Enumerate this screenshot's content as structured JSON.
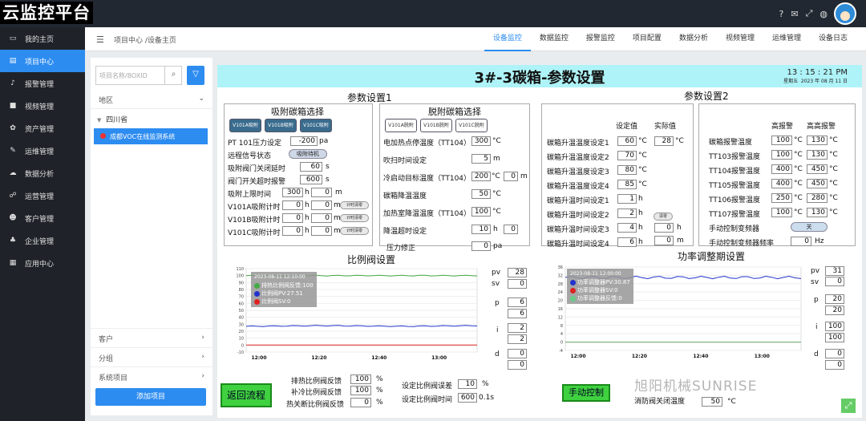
{
  "app": {
    "logo": "云监控平台"
  },
  "topbar_icons": [
    "?",
    "✉",
    "⤢",
    "◍"
  ],
  "sidebar": [
    {
      "label": "我的主页",
      "icon": "▭"
    },
    {
      "label": "项目中心",
      "icon": "▤",
      "active": true
    },
    {
      "label": "报警管理",
      "icon": "♪"
    },
    {
      "label": "视频管理",
      "icon": "■"
    },
    {
      "label": "资产管理",
      "icon": "✿"
    },
    {
      "label": "运维管理",
      "icon": "✎"
    },
    {
      "label": "数据分析",
      "icon": "☁"
    },
    {
      "label": "运营管理",
      "icon": "☍"
    },
    {
      "label": "客户管理",
      "icon": "☻"
    },
    {
      "label": "企业管理",
      "icon": "♣"
    },
    {
      "label": "应用中心",
      "icon": "▦"
    }
  ],
  "header": {
    "breadcrumb": "项目中心 /设备主页",
    "tabs": [
      "设备监控",
      "数据监控",
      "报警监控",
      "项目配置",
      "数据分析",
      "视频管理",
      "运维管理",
      "设备日志"
    ]
  },
  "left": {
    "search_placeholder": "项目名称/BOXID",
    "region": "地区",
    "province": "四川省",
    "project": "成都VOC在线监测系统",
    "bottom": [
      "客户",
      "分组",
      "系统项目"
    ],
    "add_button": "添加项目"
  },
  "main": {
    "title": "3#-3碳箱-参数设置",
    "time": "13 : 15 : 21  PM",
    "date_label": "星期五",
    "date": "2023 年 08 月 11 日",
    "params1": {
      "title": "参数设置1",
      "adsorb": {
        "title": "吸附碳箱选择",
        "buttons": [
          "V101A吸附",
          "V101B吸附",
          "V101C吸附"
        ],
        "pt101_label": "PT 101压力设定",
        "pt101": "-200",
        "pt101_unit": "pa",
        "remote_label": "远程信号状态",
        "remote": "吸附待机",
        "valve_delay_label": "吸附阀门关闭延时",
        "valve_delay": "60",
        "valve_delay_unit": "s",
        "valve_timeout_label": "阀门开关超时报警",
        "valve_timeout": "600",
        "valve_timeout_unit": "s",
        "limit_label": "吸附上限时间",
        "limit_h": "300",
        "limit_m": "0",
        "timers": [
          {
            "label": "V101A吸附计时",
            "h": "0",
            "m": "0",
            "btn": "计时清零"
          },
          {
            "label": "V101B吸附计时",
            "h": "0",
            "m": "0",
            "btn": "计时清零"
          },
          {
            "label": "V101C吸附计时",
            "h": "0",
            "m": "0",
            "btn": "计时清零"
          }
        ]
      },
      "desorb": {
        "title": "脱附碳箱选择",
        "buttons": [
          "V101A脱附",
          "V101B脱附",
          "V101C脱附"
        ],
        "heater_stop_label": "电加热点停温度（TT104）",
        "heater_stop": "300",
        "heater_stop_unit": "°C",
        "blow_label": "吹扫时间设定",
        "blow": "5",
        "blow_unit": "m",
        "cool_label": "冷启动目标温度（TT104）",
        "cool": "200",
        "cool_unit": "°C",
        "cool_m": "0",
        "cool_m_unit": "m",
        "cool_temp_label": "碳箱降温温度",
        "cool_temp": "50",
        "cool_temp_unit": "°C",
        "heat_cool_label": "加热室降温温度（TT104）",
        "heat_cool": "100",
        "heat_cool_unit": "°C",
        "cool_timeout_label": "降温超时设定",
        "cool_timeout_h": "10",
        "cool_timeout_m": "0",
        "press_label": "压力修正",
        "press": "0",
        "press_unit": "pa",
        "h_unit": "h",
        "m_unit": "m",
        "c_unit": "°C"
      }
    },
    "params2": {
      "title": "参数设置2",
      "set_header": "设定值",
      "actual_header": "实际值",
      "rows": [
        {
          "label": "碳箱升温温度设定1",
          "val": "60",
          "unit": "°C"
        },
        {
          "label": "碳箱升温温度设定2",
          "val": "70",
          "unit": "°C"
        },
        {
          "label": "碳箱升温温度设定3",
          "val": "80",
          "unit": "°C"
        },
        {
          "label": "碳箱升温温度设定4",
          "val": "85",
          "unit": "°C"
        },
        {
          "label": "碳箱升温时间设定1",
          "val": "1",
          "unit": "h"
        },
        {
          "label": "碳箱升温时间设定2",
          "val": "2",
          "unit": "h"
        },
        {
          "label": "碳箱升温时间设定3",
          "val": "4",
          "unit": "h"
        },
        {
          "label": "碳箱升温时间设定4",
          "val": "6",
          "unit": "h"
        }
      ],
      "actual_temp": "28",
      "actual_temp_unit": "°C",
      "actual_h": "0",
      "actual_h_unit": "h",
      "actual_m": "0",
      "actual_m_unit": "m",
      "clear_btn": "清零",
      "alarm_high_header": "高报警",
      "alarm_hh_header": "高高报警",
      "alarms": [
        {
          "label": "碳箱报警温度",
          "high": "100",
          "hh": "130"
        },
        {
          "label": "TT103报警温度",
          "high": "100",
          "hh": "130"
        },
        {
          "label": "TT104报警温度",
          "high": "400",
          "hh": "450"
        },
        {
          "label": "TT105报警温度",
          "high": "400",
          "hh": "450"
        },
        {
          "label": "TT106报警温度",
          "high": "250",
          "hh": "280"
        },
        {
          "label": "TT107报警温度",
          "high": "100",
          "hh": "130"
        }
      ],
      "alarm_unit": "°C",
      "manual_freq_label": "手动控制变频器",
      "manual_freq": "关",
      "manual_freq_val_label": "手动控制变频器频率",
      "manual_freq_val": "0",
      "manual_freq_unit": "Hz"
    },
    "prop_valve": {
      "title": "比例阀设置",
      "tooltip_time": "2023-08-11 12:10:00",
      "tooltip": [
        {
          "text": "排热比例阀反馈:100",
          "color": "#44aa44"
        },
        {
          "text": "比例阀PV:27.51",
          "color": "#2233cc"
        },
        {
          "text": "比例阀SV:0",
          "color": "#dd2222"
        }
      ],
      "pv_label": "pv",
      "pv": "28",
      "sv_label": "sv",
      "sv": "0",
      "p_label": "p",
      "p1": "6",
      "p2": "6",
      "i_label": "i",
      "i1": "2",
      "i2": "2",
      "d_label": "d",
      "d1": "0",
      "d2": "0",
      "exhaust_label": "排热比例阀反馈",
      "exhaust": "100",
      "cool_label": "补冷比例阀反馈",
      "cool": "100",
      "hot_label": "热关断比例阀反馈",
      "hot": "0",
      "pct": "%",
      "err_label": "设定比例阀误差",
      "err": "10",
      "err_unit": "%",
      "time_label": "设定比例阀时间",
      "time": "600",
      "time_unit": "0.1s",
      "return_btn": "返回流程"
    },
    "power": {
      "title": "功率调整期设置",
      "tooltip_time": "2023-08-11 12:00:00",
      "tooltip": [
        {
          "text": "功率调整器PV:30.87",
          "color": "#2233cc"
        },
        {
          "text": "功率调整器SV:0",
          "color": "#dd2222"
        },
        {
          "text": "功率调整器反馈:0",
          "color": "#66cc88"
        }
      ],
      "pv_label": "pv",
      "pv": "31",
      "sv_label": "sv",
      "sv": "0",
      "p_label": "p",
      "p1": "20",
      "p2": "20",
      "i_label": "i",
      "i1": "100",
      "i2": "100",
      "d_label": "d",
      "d1": "0",
      "d2": "0",
      "manual_btn": "手动控制",
      "fire_label": "消防阀关闭温度",
      "fire": "50",
      "fire_unit": "°C",
      "watermark": "旭阳机械SUNRISE"
    }
  },
  "chart_data": [
    {
      "type": "line",
      "title": "比例阀设置",
      "x": [
        "12:00",
        "12:20",
        "12:40",
        "13:00"
      ],
      "ylim": [
        -10,
        110
      ],
      "yticks": [
        -10,
        0,
        10,
        20,
        30,
        40,
        50,
        60,
        70,
        80,
        90,
        100,
        110
      ],
      "series": [
        {
          "values": [
            100,
            100,
            100,
            100
          ],
          "color": "#44aa44"
        },
        {
          "values": [
            27,
            28,
            27,
            28
          ],
          "color": "#2233cc"
        },
        {
          "values": [
            0,
            0,
            0,
            0
          ],
          "color": "#dd2222"
        }
      ]
    },
    {
      "type": "line",
      "title": "功率调整期设置",
      "x": [
        "12:00",
        "12:20",
        "12:40",
        "13:00"
      ],
      "ylim": [
        -4,
        36
      ],
      "yticks": [
        -4,
        0,
        4,
        8,
        12,
        16,
        20,
        24,
        28,
        32,
        36
      ],
      "series": [
        {
          "values": [
            31,
            31,
            31,
            31
          ],
          "color": "#2233cc"
        },
        {
          "values": [
            0,
            0,
            0,
            0
          ],
          "color": "#dd2222"
        },
        {
          "values": [
            0,
            0,
            0,
            0
          ],
          "color": "#66cc88"
        }
      ]
    }
  ]
}
